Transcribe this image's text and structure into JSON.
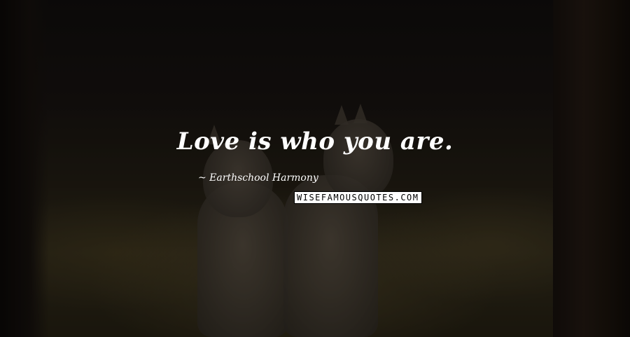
{
  "quote": {
    "text": "Love is who you are.",
    "author": "~ Earthschool Harmony"
  },
  "watermark": {
    "text": "WISEFAMOUSQUOTES.COM"
  },
  "colors": {
    "text": "#ffffff",
    "watermark_bg": "#ffffff",
    "watermark_fg": "#000000"
  }
}
